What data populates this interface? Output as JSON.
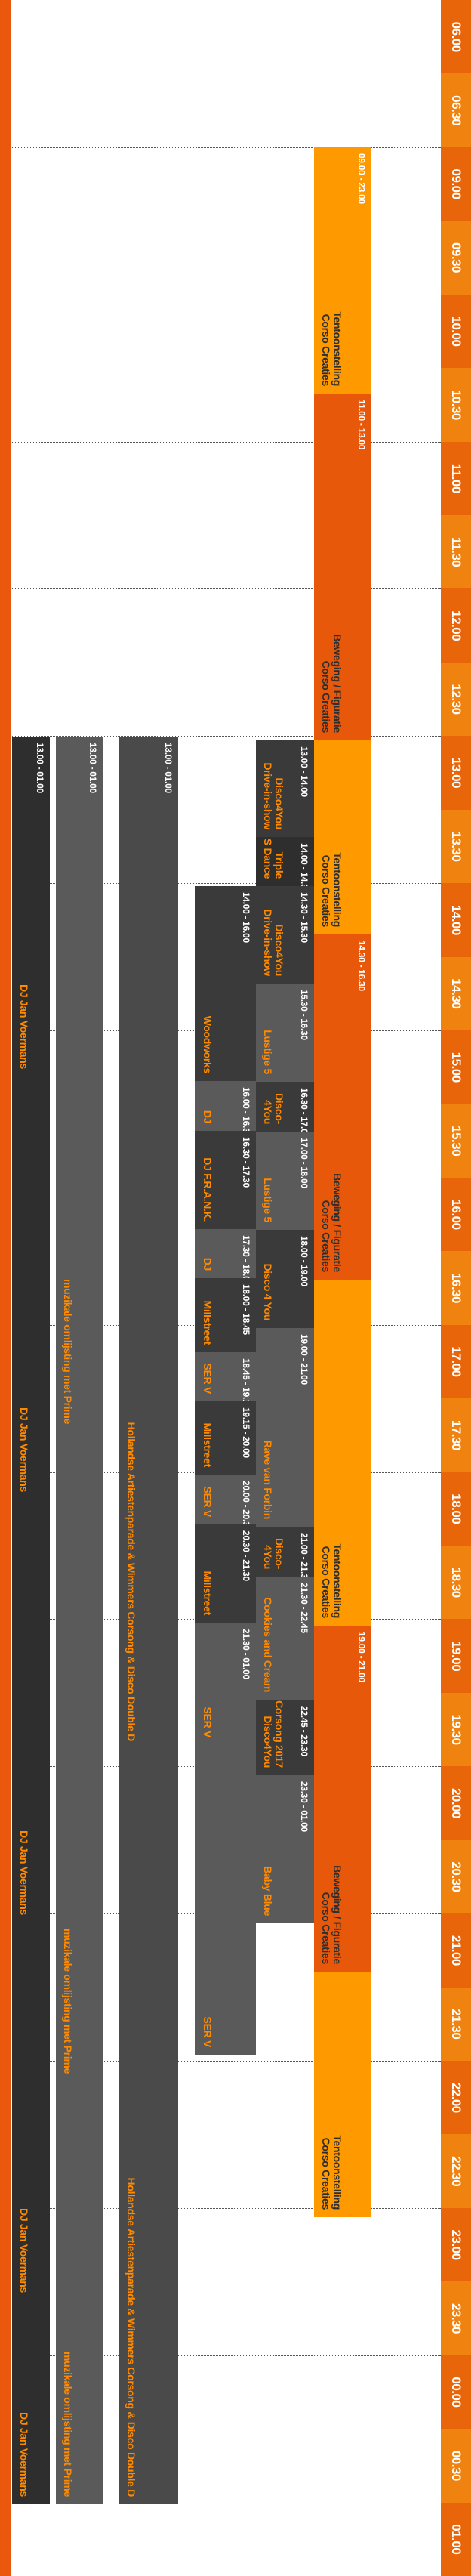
{
  "colors": {
    "header": "#ff7a00",
    "accent_text": "#ff8a00",
    "dark": "#3a3a3a",
    "gray": "#5a5a5a"
  },
  "timeline": {
    "labels": [
      "06.00",
      "06.30",
      "09.00",
      "09.30",
      "10.00",
      "10.30",
      "11.00",
      "11.30",
      "12.00",
      "12.30",
      "13.00",
      "13.30",
      "14.00",
      "14.30",
      "15.00",
      "15.30",
      "16.00",
      "16.30",
      "17.00",
      "17.30",
      "18.00",
      "18.30",
      "19.00",
      "19.30",
      "20.00",
      "20.30",
      "21.00",
      "21.30",
      "22.00",
      "22.30",
      "23.00",
      "23.30",
      "00.00",
      "00.30",
      "01.00"
    ]
  },
  "events": [
    {
      "time": "09.00 - 23.00",
      "name": "Tentoonstelling\nCorso Creaties"
    },
    {
      "time": "11.00 - 13.00",
      "name": "Beweging / Figuratie\nCorso Creaties"
    },
    {
      "time": "",
      "name": "Tentoonstelling\nCorso Creaties"
    },
    {
      "time": "14.30 - 16.30",
      "name": "Beweging / Figuratie\nCorso Creaties"
    },
    {
      "time": "",
      "name": "Tentoonstelling\nCorso Creaties"
    },
    {
      "time": "19.00 - 21.00",
      "name": "Beweging / Figuratie\nCorso Creaties"
    },
    {
      "time": "",
      "name": "Tentoonstelling\nCorso Creaties"
    },
    {
      "time": "13.00 - 14.00",
      "name": "Disco4You\nDrive-in-show"
    },
    {
      "time": "14.00 - 14.30",
      "name": "Triple\nS Dance"
    },
    {
      "time": "14.30 - 15.30",
      "name": "Disco4You\nDrive-in-show"
    },
    {
      "time": "15.30 - 16.30",
      "name": "Lustige 5"
    },
    {
      "time": "16.30 - 17.00",
      "name": "Disco-\n4You"
    },
    {
      "time": "17.00 - 18.00",
      "name": "Lustige 5"
    },
    {
      "time": "18.00 - 19.00",
      "name": "Disco 4 You"
    },
    {
      "time": "19.00 - 21.00",
      "name": "Rave van Forbin"
    },
    {
      "time": "21.00 - 21.30",
      "name": "Disco-\n4You"
    },
    {
      "time": "21.30 - 22.45",
      "name": "Cookies and Cream"
    },
    {
      "time": "22.45 - 23.30",
      "name": "Corsong 2017\nDisco4You"
    },
    {
      "time": "23.30 - 01.00",
      "name": "Baby Blue"
    },
    {
      "time": "14.00 - 16.00",
      "name": "Woodworks"
    },
    {
      "time": "16.00 - 16.30",
      "name": "DJ"
    },
    {
      "time": "16.30 - 17.30",
      "name": "DJ F.R.A.N.K."
    },
    {
      "time": "17.30 - 18.00",
      "name": "DJ"
    },
    {
      "time": "18.00 - 18.45",
      "name": "Millstreet"
    },
    {
      "time": "18.45 - 19.15",
      "name": "SER V"
    },
    {
      "time": "19.15 - 20.00",
      "name": "Millstreet"
    },
    {
      "time": "20.00 - 20.30",
      "name": "SER V"
    },
    {
      "time": "20.30 - 21.30",
      "name": "Millstreet"
    },
    {
      "time": "21.30 - 01.00",
      "name": "SER V"
    },
    {
      "time": "13.00 - 01.00",
      "name": "Hollandse Artiestenparade & Wimmers Corsong & Disco Double D"
    },
    {
      "time": "13.00 - 01.00",
      "name": "muzikale omlijsting met Prime"
    },
    {
      "time": "13.00 - 01.00",
      "name": "DJ Jan Voermans"
    }
  ],
  "repeat_labels": {
    "hollandse": "Hollandse Artiestenparade & Wimmers Corsong & Disco Double D",
    "prime": "muzikale omlijsting met Prime",
    "dj": "DJ Jan Voermans",
    "serv": "SER V"
  }
}
